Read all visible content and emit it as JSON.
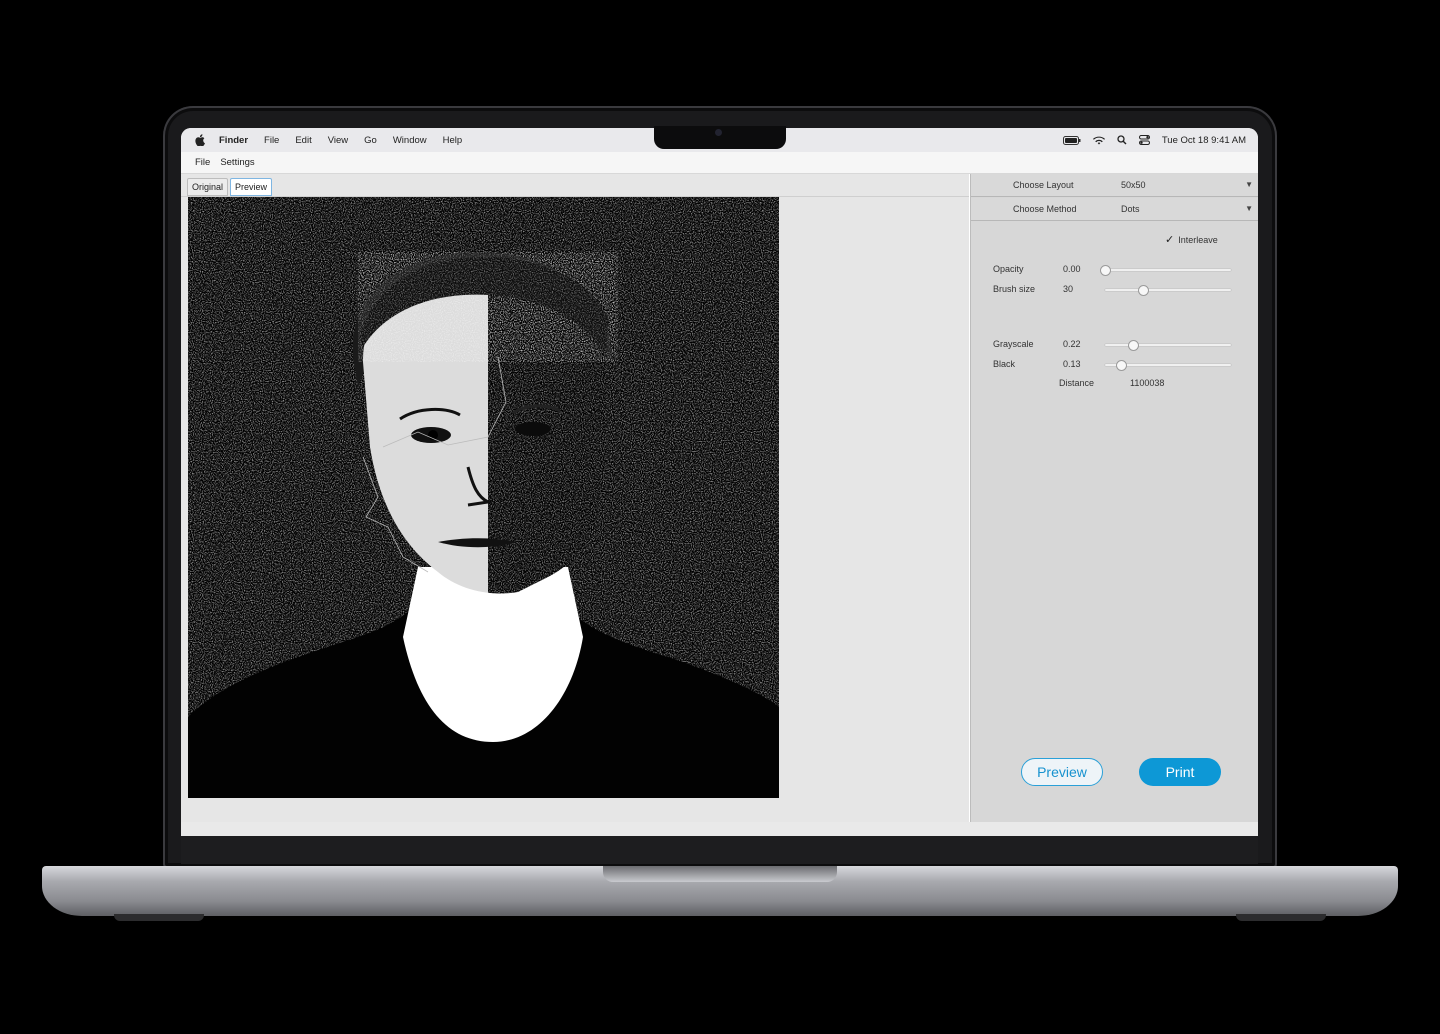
{
  "menubar": {
    "items": [
      "Finder",
      "File",
      "Edit",
      "View",
      "Go",
      "Window",
      "Help"
    ],
    "clock": "Tue Oct 18  9:41 AM"
  },
  "app": {
    "menu": [
      "File",
      "Settings"
    ],
    "tabs": [
      "Original",
      "Preview"
    ],
    "active_tab": "Preview"
  },
  "settings": {
    "layout": {
      "label": "Choose Layout",
      "value": "50x50"
    },
    "method": {
      "label": "Choose Method",
      "value": "Dots"
    },
    "interleave": {
      "label": "Interleave",
      "checked": true,
      "glyph": "✓"
    },
    "opacity": {
      "label": "Opacity",
      "value": "0.00",
      "level": 0.0
    },
    "brush": {
      "label": "Brush size",
      "value": "30",
      "level": 0.3
    },
    "grayscale": {
      "label": "Grayscale",
      "value": "0.22",
      "level": 0.22
    },
    "black": {
      "label": "Black",
      "value": "0.13",
      "level": 0.13
    },
    "distance": {
      "label": "Distance",
      "value": "1100038"
    }
  },
  "buttons": {
    "preview": "Preview",
    "print": "Print"
  },
  "colors": {
    "accent": "#0d98d6",
    "panel": "#d7d7d7"
  }
}
